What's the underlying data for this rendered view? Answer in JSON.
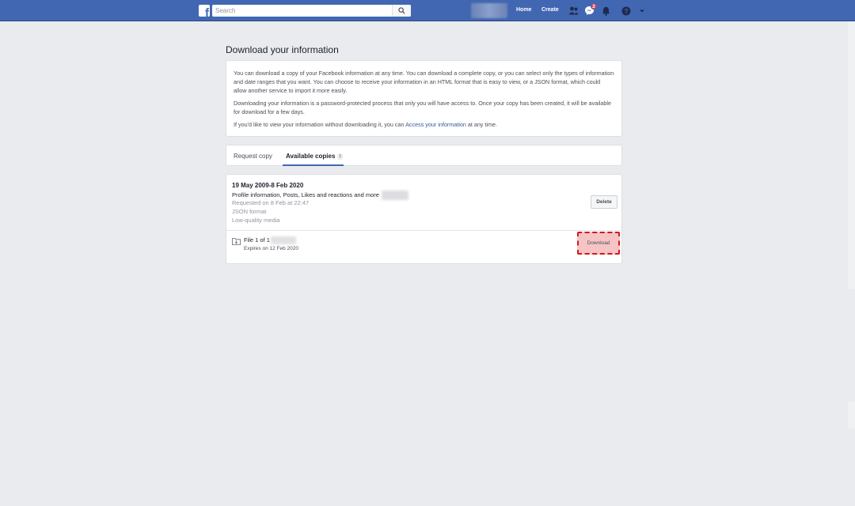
{
  "header": {
    "logo_letter": "f",
    "search_placeholder": "Search",
    "nav": {
      "home": "Home",
      "create": "Create"
    },
    "notification_badge": "2"
  },
  "page_title": "Download your information",
  "intro": {
    "p1": "You can download a copy of your Facebook information at any time. You can download a complete copy, or you can select only the types of information and date ranges that you want. You can choose to receive your information in an HTML format that is easy to view, or a JSON format, which could allow another service to import it more easily.",
    "p2": "Downloading your information is a password-protected process that only you will have access to. Once your copy has been created, it will be available for download for a few days.",
    "p3_before": "If you'd like to view your information without downloading it, you can ",
    "p3_link": "Access your information",
    "p3_after": " at any time."
  },
  "tabs": {
    "request": "Request copy",
    "available": "Available copies",
    "available_count": "1"
  },
  "copy": {
    "range": "19 May 2009-8 Feb 2020",
    "description": "Profile information, Posts, Likes and reactions and more",
    "requested": "Requested on 8 Feb at 22:47",
    "format": "JSON format",
    "media": "Low-quality media",
    "delete_label": "Delete",
    "file_label": "File 1 of 1",
    "file_expires": "Expires on 12 Feb 2020",
    "download_label": "Download"
  },
  "colors": {
    "brand": "#4267b2",
    "link": "#385898",
    "highlight_border": "#d0181f"
  }
}
